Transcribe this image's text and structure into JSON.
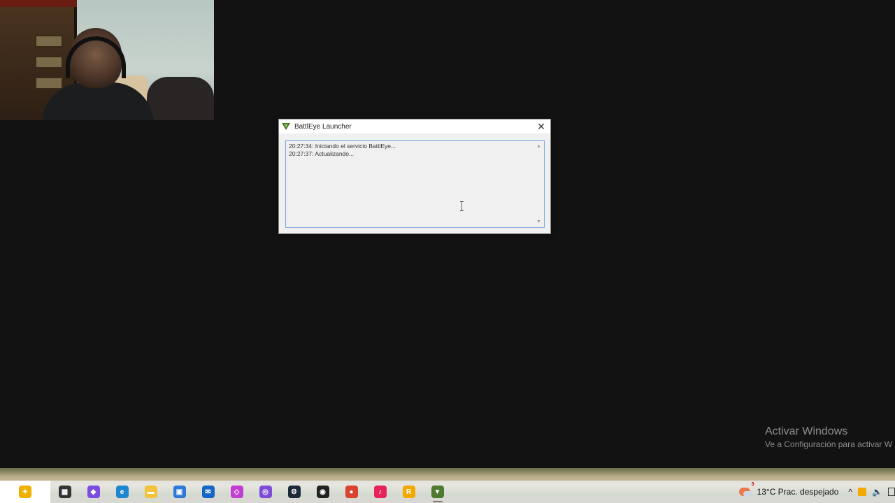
{
  "dialog": {
    "title": "BattlEye Launcher",
    "close_glyph": "✕",
    "log_lines": [
      "20:27:34: Iniciando el servicio BattlEye...",
      "20:27:37: Actualizando..."
    ]
  },
  "watermark": {
    "title": "Activar Windows",
    "subtitle": "Ve a Configuración para activar W"
  },
  "taskbar": {
    "icons": [
      {
        "name": "copilot-sparkle-icon",
        "color": "#f0b000",
        "glyph": "✦"
      },
      {
        "name": "task-view-icon",
        "color": "#333333",
        "glyph": "▦"
      },
      {
        "name": "copilot-app-icon",
        "color": "#7a4de0",
        "glyph": "◆"
      },
      {
        "name": "edge-browser-icon",
        "color": "#1f86d0",
        "glyph": "e"
      },
      {
        "name": "file-explorer-icon",
        "color": "#f2c23a",
        "glyph": "▬"
      },
      {
        "name": "microsoft-store-icon",
        "color": "#2f79d6",
        "glyph": "▣"
      },
      {
        "name": "outlook-icon",
        "color": "#1666c5",
        "glyph": "✉"
      },
      {
        "name": "ms-365-icon",
        "color": "#c03ed0",
        "glyph": "◇"
      },
      {
        "name": "gaming-app-icon",
        "color": "#7d4dd8",
        "glyph": "◎"
      },
      {
        "name": "steam-icon",
        "color": "#1b2838",
        "glyph": "⚙"
      },
      {
        "name": "obs-studio-icon",
        "color": "#222222",
        "glyph": "◉"
      },
      {
        "name": "chrome-icon",
        "color": "#d9442e",
        "glyph": "●"
      },
      {
        "name": "tiktok-icon",
        "color": "#e8235b",
        "glyph": "♪"
      },
      {
        "name": "rockstar-launcher-icon",
        "color": "#f3a900",
        "glyph": "R"
      },
      {
        "name": "battleye-launcher-icon",
        "color": "#4c7a2e",
        "glyph": "▼"
      }
    ],
    "weather_badge": "3",
    "weather_text": "13°C  Prac. despejado",
    "tray_chevron": "^",
    "speaker_glyph": "🔈"
  }
}
